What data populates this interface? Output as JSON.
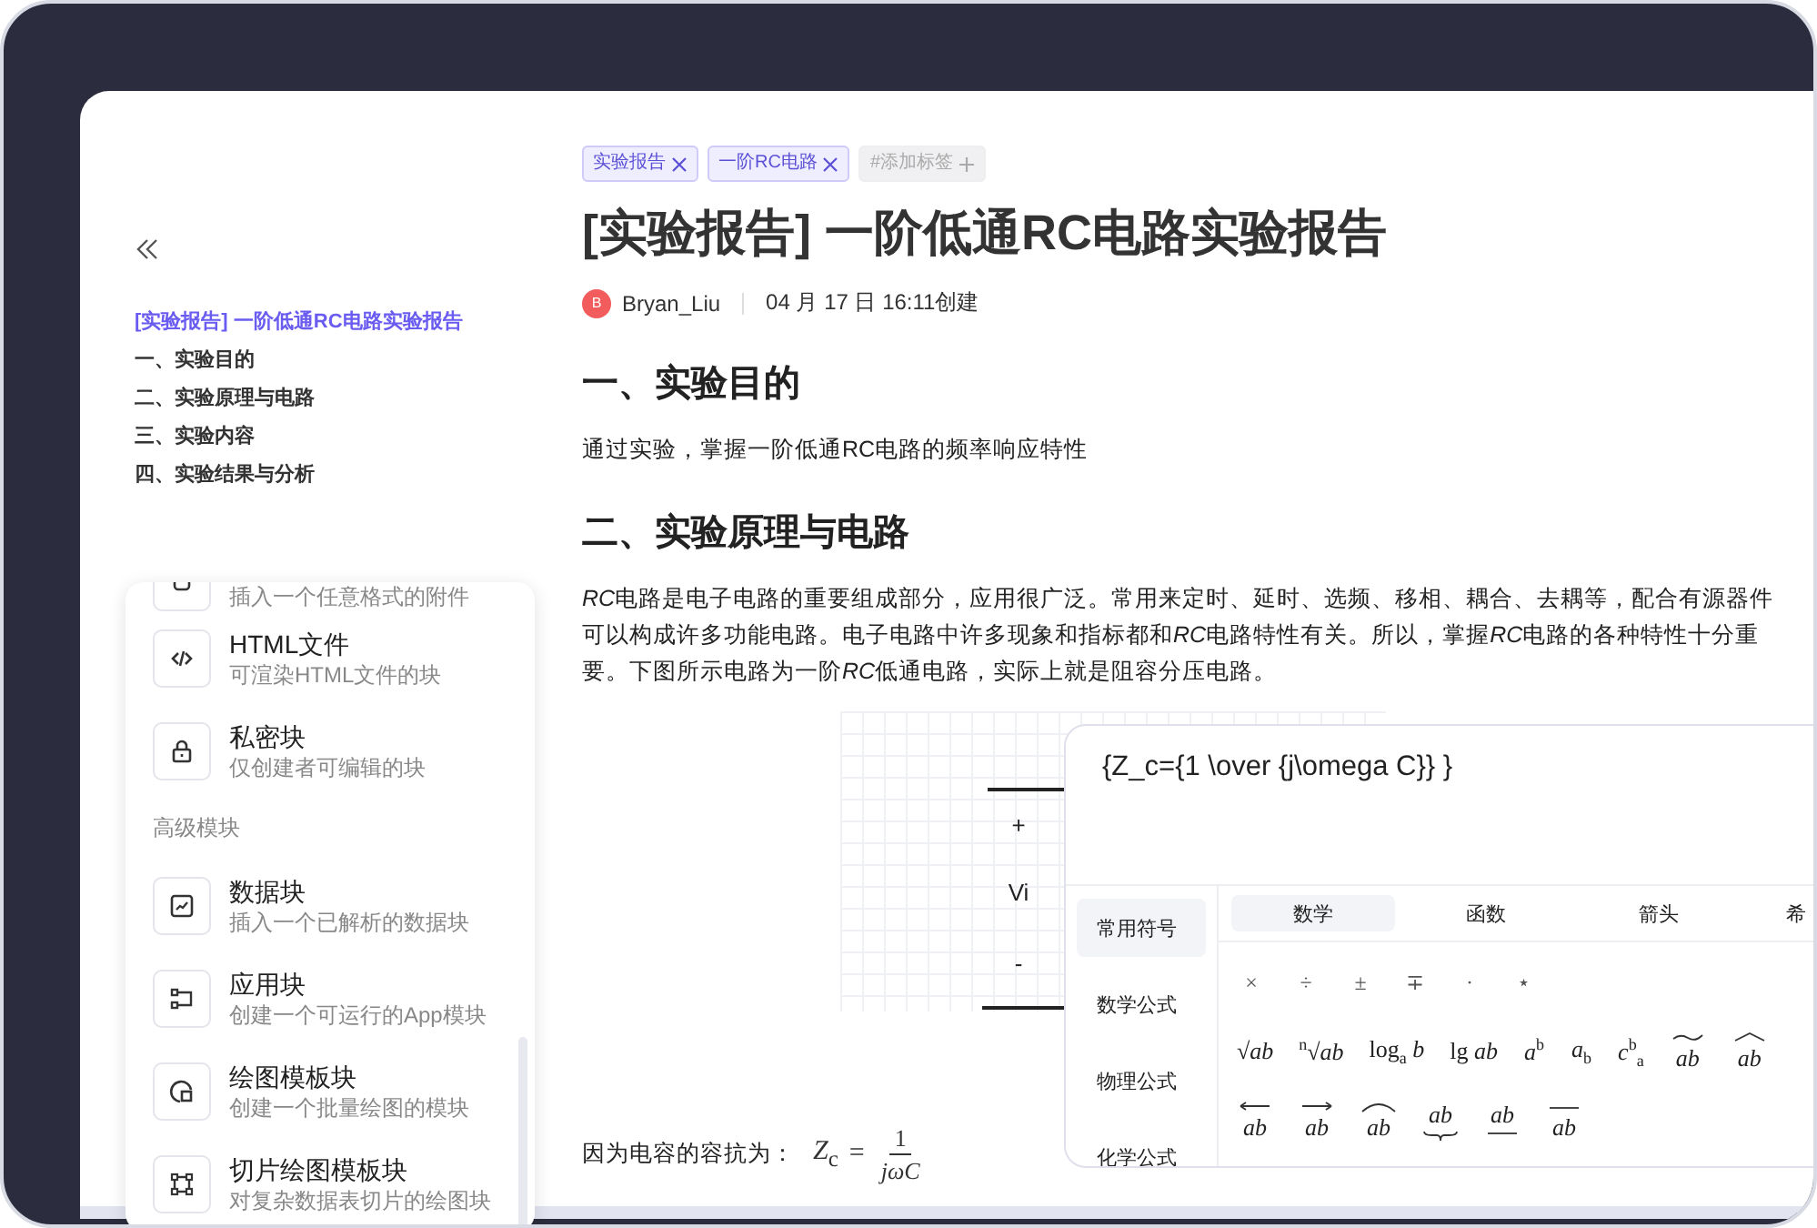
{
  "sidebar": {
    "toc": [
      {
        "label": "[实验报告] 一阶低通RC电路实验报告",
        "selected": true
      },
      {
        "label": "一、实验目的",
        "selected": false
      },
      {
        "label": "二、实验原理与电路",
        "selected": false
      },
      {
        "label": "三、实验内容",
        "selected": false
      },
      {
        "label": "四、实验结果与分析",
        "selected": false
      }
    ]
  },
  "block_menu": {
    "items": [
      {
        "kind": "item",
        "description": "插入一个任意格式的附件"
      },
      {
        "kind": "item",
        "title": "HTML文件",
        "description": "可渲染HTML文件的块"
      },
      {
        "kind": "item",
        "title": "私密块",
        "description": "仅创建者可编辑的块"
      },
      {
        "kind": "section",
        "label": "高级模块"
      },
      {
        "kind": "item",
        "title": "数据块",
        "description": "插入一个已解析的数据块"
      },
      {
        "kind": "item",
        "title": "应用块",
        "description": "创建一个可运行的App模块"
      },
      {
        "kind": "item",
        "title": "绘图模板块",
        "description": "创建一个批量绘图的模块"
      },
      {
        "kind": "item",
        "title": "切片绘图模板块",
        "description": "对复杂数据表切片的绘图块"
      }
    ]
  },
  "document": {
    "tags": [
      {
        "label": "实验报告"
      },
      {
        "label": "一阶RC电路"
      }
    ],
    "add_tag": "#添加标签",
    "title": "[实验报告] 一阶低通RC电路实验报告",
    "author": {
      "initial": "B",
      "name": "Bryan_Liu"
    },
    "created": "04 月 17 日 16:11创建",
    "sections": [
      {
        "heading": "一、实验目的",
        "paragraphs": [
          "通过实验，掌握一阶低通RC电路的频率响应特性"
        ]
      },
      {
        "heading": "二、实验原理与电路",
        "paragraphs": [
          [
            {
              "text": "RC",
              "italic": true
            },
            {
              "text": "电路是电子电路的重要组成部分，应用很广泛。常用来定时、延时、选频、移相、耦合、去耦等，配合有源器件可以构成许多功能电路。电子电路中许多现象和指标都和",
              "italic": false
            },
            {
              "text": "RC",
              "italic": true
            },
            {
              "text": "电路特性有关。所以，掌握",
              "italic": false
            },
            {
              "text": "RC",
              "italic": true
            },
            {
              "text": "电路的各种特性十分重要。下图所示电路为一阶",
              "italic": false
            },
            {
              "text": "RC",
              "italic": true
            },
            {
              "text": "低通电路，实际上就是阻容分压电路。",
              "italic": false
            }
          ]
        ]
      }
    ],
    "circuit": {
      "labels": [
        "+",
        "Vi",
        "-"
      ]
    },
    "formula": {
      "intro": "因为电容的容抗为：",
      "lhs": "*Z*$_{c}$",
      "relation": "=",
      "numerator": "1",
      "denominator": "*jωC*"
    }
  },
  "formula_editor": {
    "input": "{Z_c={1 \\over {j\\omega C}} }",
    "categories": [
      {
        "label": "常用符号",
        "selected": true
      },
      {
        "label": "数学公式",
        "selected": false
      },
      {
        "label": "物理公式",
        "selected": false
      },
      {
        "label": "化学公式",
        "selected": false
      }
    ],
    "tabs": [
      {
        "label": "数学",
        "selected": true
      },
      {
        "label": "函数",
        "selected": false
      },
      {
        "label": "箭头",
        "selected": false
      },
      {
        "label": "希",
        "selected": false
      }
    ],
    "symbol_rows": [
      [
        {
          "text": "×"
        },
        {
          "text": "÷"
        },
        {
          "text": "±"
        },
        {
          "text": "∓"
        },
        {
          "text": "·"
        },
        {
          "text": "⋆"
        }
      ],
      [
        {
          "text": "√*ab*"
        },
        {
          "text": "$^{n}$√*ab*"
        },
        {
          "text": "log$_{a}$ *b*"
        },
        {
          "text": "lg *ab*"
        },
        {
          "text": "*a*$^{b}$"
        },
        {
          "text": "*a*$_{b}$"
        },
        {
          "text": "*c*$^{b}$$_{a}$"
        },
        {
          "text": "*ab*",
          "kind": "tilde"
        },
        {
          "text": "*ab*",
          "kind": "hat"
        }
      ],
      [
        {
          "text": "*ab*",
          "kind": "leftarrow"
        },
        {
          "text": "*ab*",
          "kind": "rightarrow"
        },
        {
          "text": "*ab*",
          "kind": "arc"
        },
        {
          "text": "*ab*",
          "kind": "underbrace"
        },
        {
          "text": "*ab*",
          "kind": "underline"
        },
        {
          "text": "*ab*",
          "kind": "overline"
        }
      ]
    ]
  }
}
